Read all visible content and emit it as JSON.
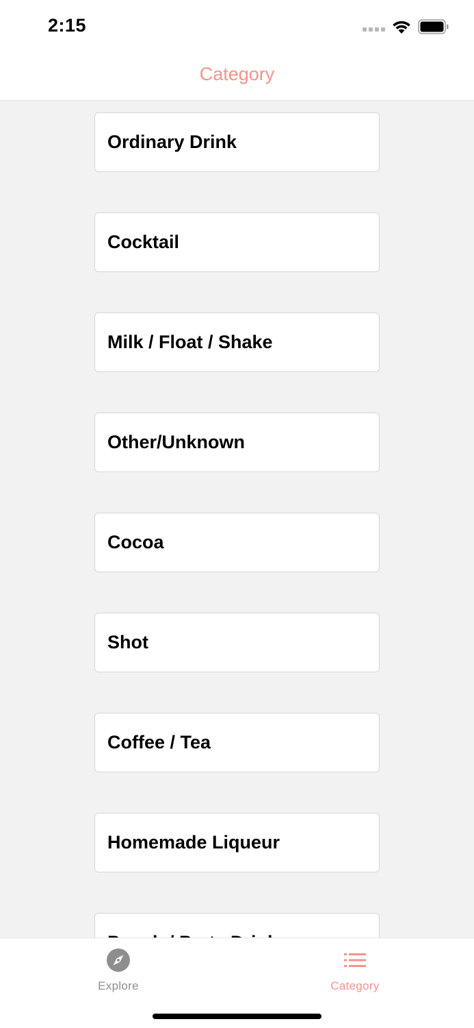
{
  "status_bar": {
    "time": "2:15"
  },
  "nav": {
    "title": "Category"
  },
  "categories": [
    "Ordinary Drink",
    "Cocktail",
    "Milk / Float / Shake",
    "Other/Unknown",
    "Cocoa",
    "Shot",
    "Coffee / Tea",
    "Homemade Liqueur",
    "Punch / Party Drink"
  ],
  "tabs": [
    {
      "label": "Explore",
      "icon": "compass-icon",
      "active": false
    },
    {
      "label": "Category",
      "icon": "list-icon",
      "active": true
    }
  ],
  "colors": {
    "accent": "#f5928e",
    "inactive": "#8e8e8e",
    "background": "#f2f2f2"
  }
}
